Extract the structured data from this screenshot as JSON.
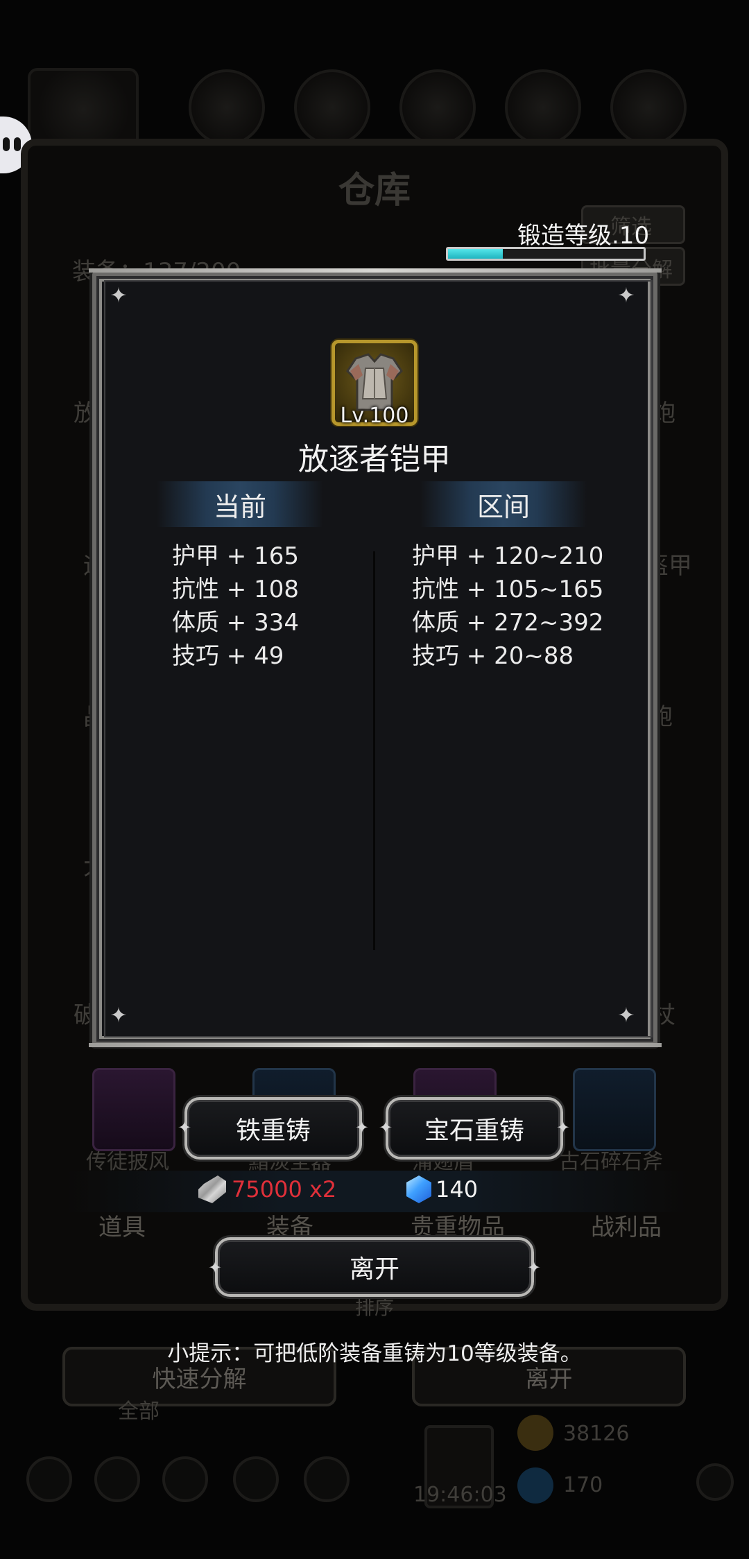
{
  "background": {
    "title": "仓库",
    "equipment_label": "装备：137/200",
    "filter_label": "筛选",
    "batch_label": "批量分解",
    "side_left": [
      "放",
      "运",
      "晶",
      "大",
      "破"
    ],
    "side_right": [
      "炮",
      "盔甲",
      "鲍",
      "",
      "杖"
    ],
    "bottom_items": [
      "传徒披风",
      "黯淡圣器",
      "蒲翅盾",
      "古石碎石斧"
    ],
    "categories": [
      "道具",
      "装备",
      "贵重物品",
      "战利品"
    ],
    "sort_label": "排序",
    "quick_decompose_label": "快速分解",
    "leave_label": "离开",
    "all_label": "全部",
    "time": "19:46:03",
    "gold": "38126",
    "gems": "170"
  },
  "forge": {
    "label": "锻造等级.10",
    "progress": 0.28
  },
  "item": {
    "level": "Lv.100",
    "name": "放逐者铠甲"
  },
  "columns": {
    "current_header": "当前",
    "range_header": "区间"
  },
  "stats": {
    "current": [
      "护甲 + 165",
      "抗性 + 108",
      "体质 + 334",
      "技巧 + 49"
    ],
    "range": [
      "护甲 + 120~210",
      "抗性 + 105~165",
      "体质 + 272~392",
      "技巧 + 20~88"
    ]
  },
  "actions": {
    "iron_reforge": "铁重铸",
    "gem_reforge": "宝石重铸",
    "leave": "离开"
  },
  "costs": {
    "iron": "75000 x2",
    "gem": "140",
    "iron_color": "#e0303a",
    "forge_bar_color": "#3fd0d8"
  },
  "tip": "小提示：可把低阶装备重铸为10等级装备。"
}
